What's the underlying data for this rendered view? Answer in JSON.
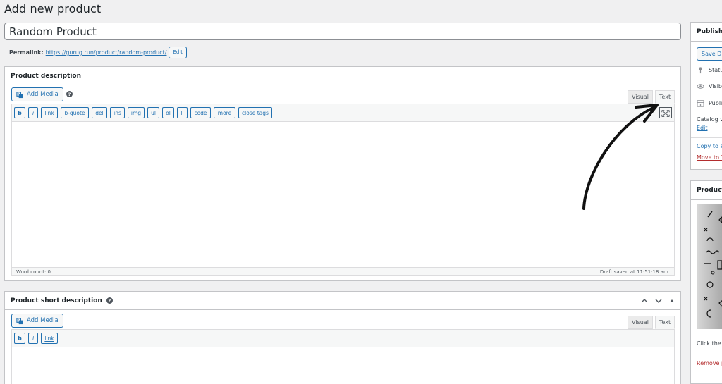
{
  "page": {
    "title": "Add new product"
  },
  "title_field": {
    "value": "Random Product"
  },
  "permalink": {
    "label": "Permalink:",
    "url": "https://gurug.run/product/random-product/",
    "edit_label": "Edit"
  },
  "description": {
    "heading": "Product description",
    "add_media": "Add Media",
    "help": "?",
    "tabs": {
      "visual": "Visual",
      "text": "Text"
    },
    "quicktags": [
      "b",
      "i",
      "link",
      "b-quote",
      "del",
      "ins",
      "img",
      "ul",
      "ol",
      "li",
      "code",
      "more",
      "close tags"
    ],
    "word_count": "Word count: 0",
    "draft_saved": "Draft saved at 11:51:18 am."
  },
  "short_description": {
    "heading": "Product short description",
    "help": "?",
    "add_media": "Add Media",
    "tabs": {
      "visual": "Visual",
      "text": "Text"
    },
    "quicktags": [
      "b",
      "i",
      "link"
    ]
  },
  "publish": {
    "heading": "Publish",
    "save_draft": "Save Dr",
    "status": "Statu",
    "visibility": "Visib",
    "published": "Publi",
    "catalog": "Catalog v",
    "catalog_edit": "Edit",
    "copy": "Copy to a",
    "trash": "Move to T"
  },
  "product_image": {
    "heading": "Product",
    "hint": "Click the i",
    "remove": "Remove p"
  },
  "colors": {
    "accent": "#2271b1",
    "danger": "#b32d2e",
    "border": "#c3c4c7",
    "bg": "#f0f0f1"
  }
}
